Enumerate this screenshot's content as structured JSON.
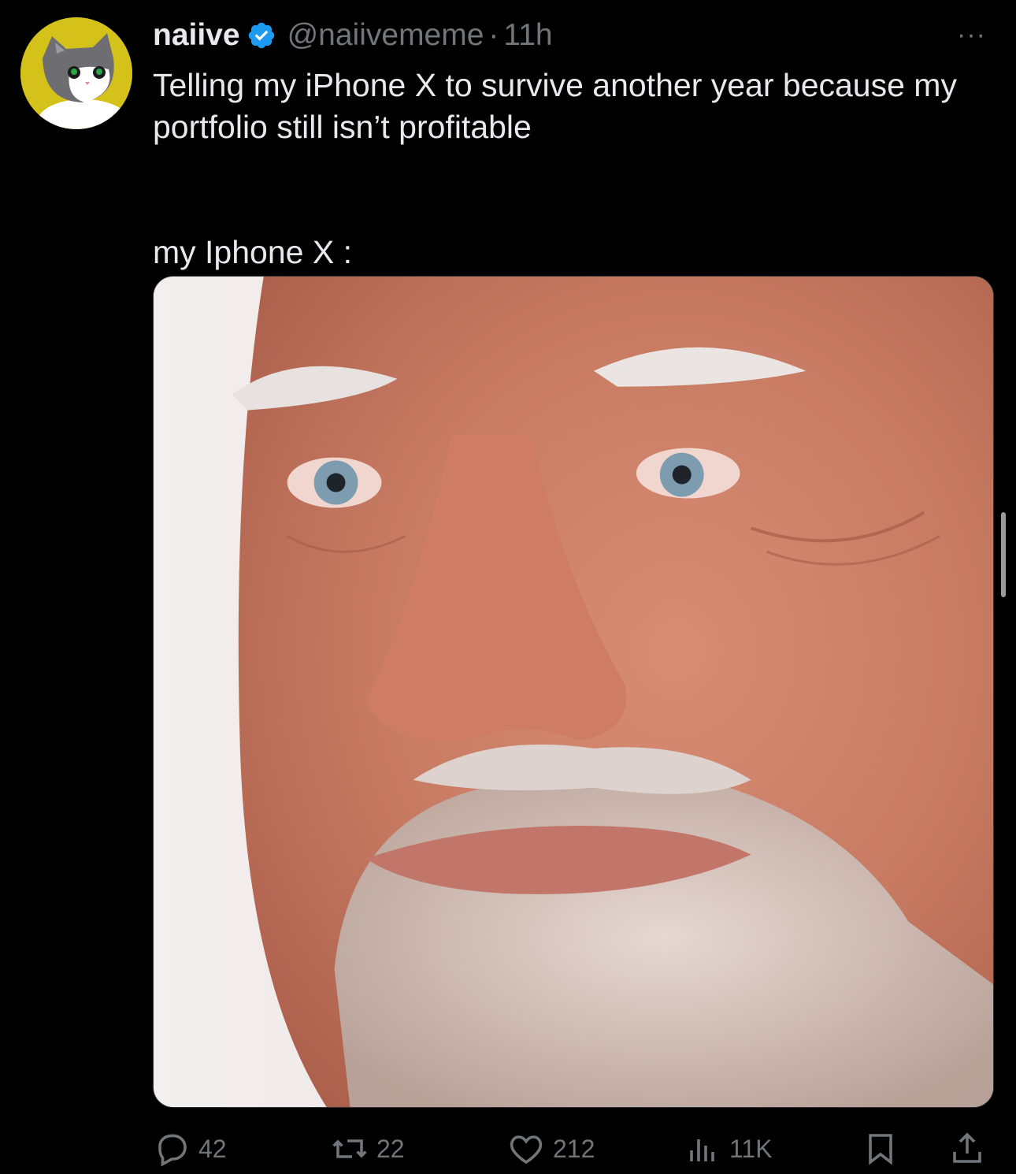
{
  "tweet": {
    "display_name": "naiive",
    "handle": "@naiivememe",
    "separator": "·",
    "time": "11h",
    "more_label": "···",
    "text_line1": "Telling my iPhone X to survive another year because my portfolio still isn’t profitable",
    "text_line2": "my Iphone X :",
    "avatar_icon": "cat-avatar",
    "verified_icon": "verified-badge-icon",
    "media_image": "meme-photo-older-man-forced-smile"
  },
  "actions": {
    "reply_count": "42",
    "retweet_count": "22",
    "like_count": "212",
    "views_count": "11K",
    "reply_icon": "reply-icon",
    "retweet_icon": "retweet-icon",
    "like_icon": "heart-icon",
    "views_icon": "views-chart-icon",
    "bookmark_icon": "bookmark-icon",
    "share_icon": "share-icon"
  },
  "colors": {
    "background": "#000000",
    "primary_text": "#e7e9ea",
    "secondary_text": "#71767b",
    "verified_blue": "#1d9bf0",
    "avatar_background": "#d4c21a"
  }
}
